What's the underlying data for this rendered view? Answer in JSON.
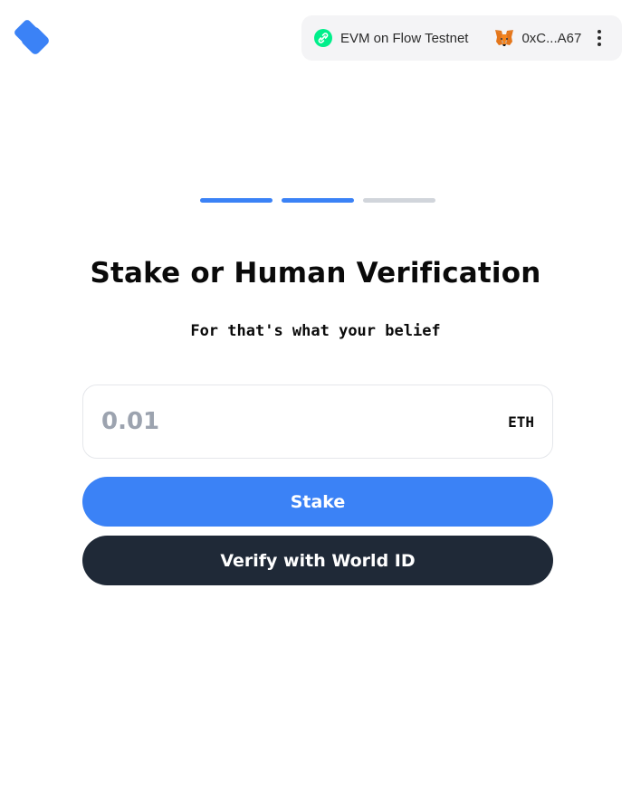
{
  "header": {
    "network_name": "EVM on Flow Testnet",
    "account_address": "0xC...A67"
  },
  "progress": {
    "total_steps": 3,
    "completed_steps": 2,
    "active_color": "#3b82f6",
    "inactive_color": "#d1d5db"
  },
  "main": {
    "title": "Stake or Human Verification",
    "subtitle": "For that's what your belief",
    "amount_placeholder": "0.01",
    "currency": "ETH",
    "stake_label": "Stake",
    "world_id_label": "Verify with World ID"
  },
  "colors": {
    "primary": "#3b82f6",
    "dark_button": "#1f2937",
    "flow_green": "#00ef8b"
  },
  "icons": {
    "logo": "diamond-logo-icon",
    "network": "flow-chain-link-icon",
    "account": "metamask-fox-icon",
    "menu": "more-vertical-icon"
  }
}
